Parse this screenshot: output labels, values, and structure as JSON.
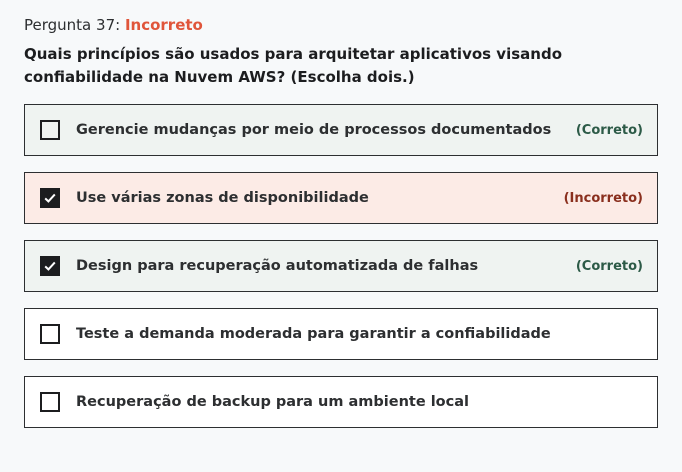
{
  "question": {
    "label": "Pergunta 37:",
    "status": "Incorreto",
    "text": "Quais princípios são usados para arquitetar aplicativos visando confiabilidade na Nuvem AWS? (Escolha dois.)"
  },
  "options": [
    {
      "label": "Gerencie mudanças por meio de processos documentados",
      "checked": false,
      "result": "(Correto)",
      "state": "correct"
    },
    {
      "label": "Use várias zonas de disponibilidade",
      "checked": true,
      "result": "(Incorreto)",
      "state": "incorrect"
    },
    {
      "label": "Design para recuperação automatizada de falhas",
      "checked": true,
      "result": "(Correto)",
      "state": "correct"
    },
    {
      "label": "Teste a demanda moderada para garantir a confiabilidade",
      "checked": false,
      "result": "",
      "state": "neutral"
    },
    {
      "label": "Recuperação de backup para um ambiente local",
      "checked": false,
      "result": "",
      "state": "neutral"
    }
  ],
  "colors": {
    "incorrect_status": "#e0553a",
    "correct_badge": "#2c5a47",
    "incorrect_badge": "#8a2f1e",
    "correct_bg": "#eff3f1",
    "incorrect_bg": "#fcebe6"
  }
}
